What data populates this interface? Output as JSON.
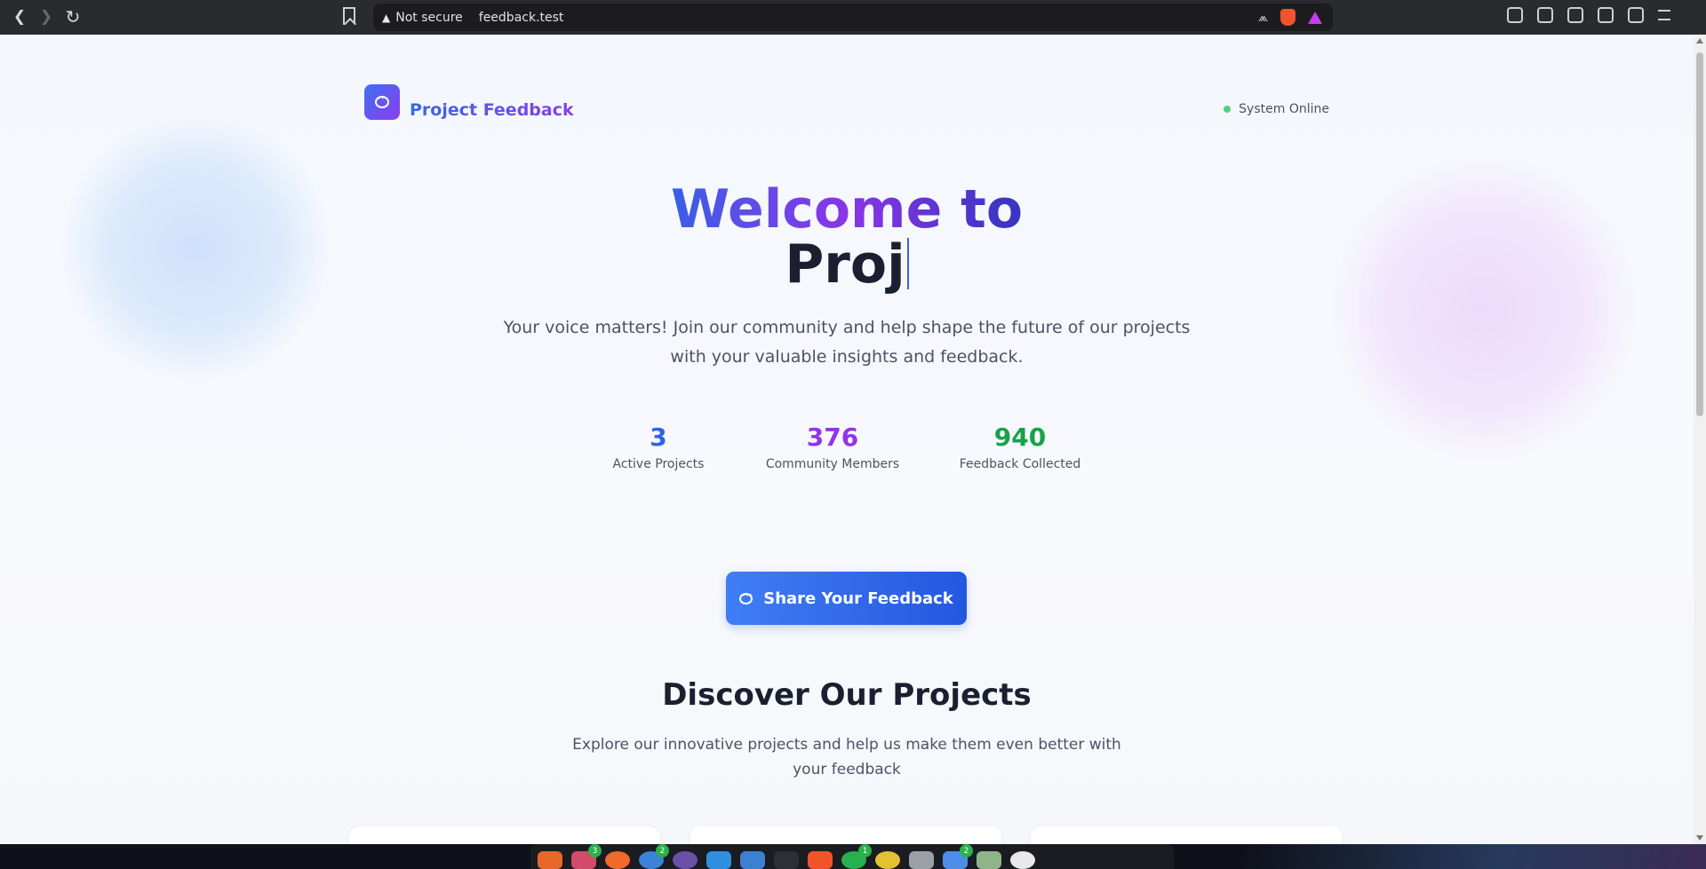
{
  "browser": {
    "security_label": "Not secure",
    "url": "feedback.test"
  },
  "header": {
    "brand": "Project Feedback",
    "status": "System Online"
  },
  "hero": {
    "title_line1": "Welcome to",
    "title_line2": "Proj",
    "subtitle": "Your voice matters! Join our community and help shape the future of our projects with your valuable insights and feedback."
  },
  "stats": [
    {
      "value": "3",
      "label": "Active Projects",
      "color": "#2f63e6"
    },
    {
      "value": "376",
      "label": "Community Members",
      "color": "#9333ea"
    },
    {
      "value": "940",
      "label": "Feedback Collected",
      "color": "#16a34a"
    }
  ],
  "cta": {
    "label": "Share Your Feedback"
  },
  "projects": {
    "title": "Discover Our Projects",
    "subtitle": "Explore our innovative projects and help us make them even better with your feedback"
  },
  "taskbar": {
    "badges": [
      "3",
      "2",
      "1",
      "2"
    ]
  }
}
